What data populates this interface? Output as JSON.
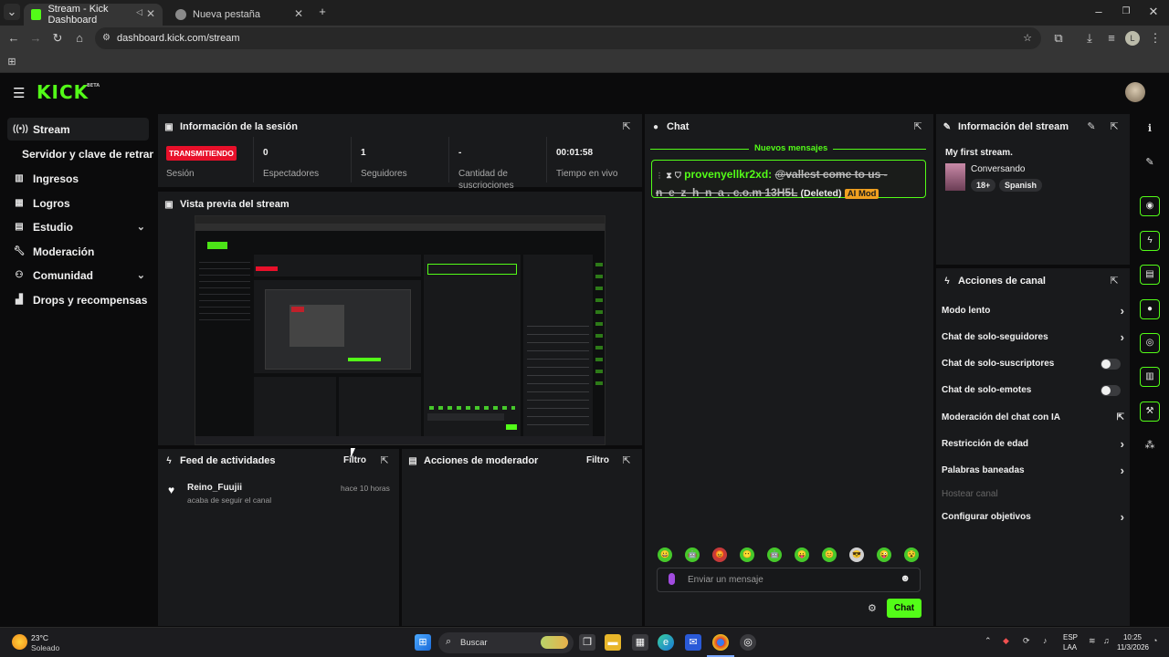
{
  "browser": {
    "tabs": [
      {
        "label": "Stream - Kick Dashboard",
        "active": true
      },
      {
        "label": "Nueva pestaña",
        "active": false
      }
    ],
    "url": "dashboard.kick.com/stream",
    "profile_initial": "L"
  },
  "kick": {
    "logo": "KICK",
    "logo_badge": "BETA"
  },
  "sidebar": {
    "items": [
      {
        "label": "Stream",
        "icon": "broadcast-icon"
      },
      {
        "label": "Servidor y clave de retransmisión",
        "icon": ""
      },
      {
        "label": "Ingresos",
        "icon": "chart-icon"
      },
      {
        "label": "Logros",
        "icon": "trophy-icon"
      },
      {
        "label": "Estudio",
        "icon": "studio-icon"
      },
      {
        "label": "Moderación",
        "icon": "wrench-icon"
      },
      {
        "label": "Comunidad",
        "icon": "people-icon"
      },
      {
        "label": "Drops y recompensas",
        "icon": "gift-icon"
      }
    ]
  },
  "session": {
    "title": "Información de la sesión",
    "status_badge": "TRANSMITIENDO",
    "status_label": "Sesión",
    "stats": [
      {
        "value": "0",
        "label": "Espectadores"
      },
      {
        "value": "1",
        "label": "Seguidores"
      },
      {
        "value": "-",
        "label": "Cantidad de suscriociones"
      },
      {
        "value": "00:01:58",
        "label": "Tiempo en vivo"
      }
    ]
  },
  "preview": {
    "title": "Vista previa del stream"
  },
  "activity": {
    "title": "Feed de actividades",
    "filter": "Filtro",
    "items": [
      {
        "user": "Reino_Fuujii",
        "action": "acaba de seguir el canal",
        "time": "hace 10 horas"
      }
    ]
  },
  "mod_actions": {
    "title": "Acciones de moderador",
    "filter": "Filtro"
  },
  "chat": {
    "title": "Chat",
    "new_messages": "Nuevos mensajes",
    "message": {
      "user": "provenyellkr2xd:",
      "text": "@vallest come to us - n_e_z_h_n_a . c.o.m 13H5L",
      "deleted": "(Deleted)",
      "tag": "AI Mod"
    },
    "emotes": [
      "😀",
      "🤖",
      "😡",
      "😶",
      "🤖",
      "😛",
      "😊",
      "😎",
      "😜",
      "😵"
    ],
    "input_placeholder": "Enviar un mensaje",
    "send_label": "Chat"
  },
  "stream_info": {
    "title": "Información del stream",
    "stream_title": "My first stream.",
    "category": "Conversando",
    "tags": [
      "18+",
      "Spanish"
    ]
  },
  "channel_actions": {
    "title": "Acciones de canal",
    "items": [
      {
        "label": "Modo lento",
        "control": "chevron"
      },
      {
        "label": "Chat de solo-seguidores",
        "control": "chevron"
      },
      {
        "label": "Chat de solo-suscriptores",
        "control": "toggle"
      },
      {
        "label": "Chat de solo-emotes",
        "control": "toggle"
      },
      {
        "label": "Moderación del chat con IA",
        "control": "external"
      },
      {
        "label": "Restricción de edad",
        "control": "chevron"
      },
      {
        "label": "Palabras baneadas",
        "control": "chevron"
      },
      {
        "label": "Hostear canal",
        "control": "disabled"
      },
      {
        "label": "Configurar objetivos",
        "control": "chevron"
      }
    ]
  },
  "taskbar": {
    "weather_temp": "23°C",
    "weather_desc": "Soleado",
    "search_placeholder": "Buscar",
    "lang_top": "ESP",
    "lang_bottom": "LAA",
    "time": "10:25",
    "date": "11/3/2026"
  },
  "colors": {
    "accent": "#53fc18",
    "live": "#e8102a",
    "ai_mod": "#f0a020"
  }
}
